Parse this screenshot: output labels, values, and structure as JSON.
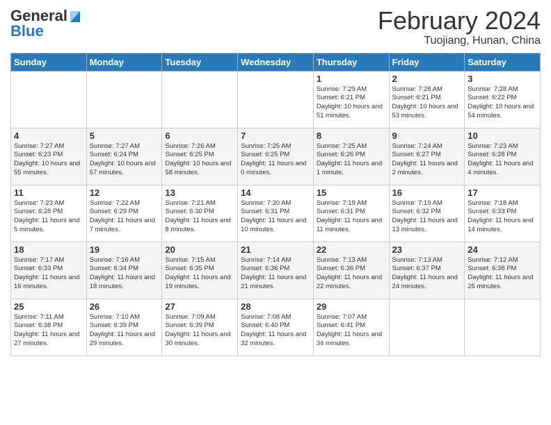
{
  "header": {
    "logo_general": "General",
    "logo_blue": "Blue",
    "title": "February 2024",
    "subtitle": "Tuojiang, Hunan, China"
  },
  "days_of_week": [
    "Sunday",
    "Monday",
    "Tuesday",
    "Wednesday",
    "Thursday",
    "Friday",
    "Saturday"
  ],
  "weeks": [
    [
      {
        "day": "",
        "info": ""
      },
      {
        "day": "",
        "info": ""
      },
      {
        "day": "",
        "info": ""
      },
      {
        "day": "",
        "info": ""
      },
      {
        "day": "1",
        "info": "Sunrise: 7:29 AM\nSunset: 6:21 PM\nDaylight: 10 hours\nand 51 minutes."
      },
      {
        "day": "2",
        "info": "Sunrise: 7:28 AM\nSunset: 6:21 PM\nDaylight: 10 hours\nand 53 minutes."
      },
      {
        "day": "3",
        "info": "Sunrise: 7:28 AM\nSunset: 6:22 PM\nDaylight: 10 hours\nand 54 minutes."
      }
    ],
    [
      {
        "day": "4",
        "info": "Sunrise: 7:27 AM\nSunset: 6:23 PM\nDaylight: 10 hours\nand 55 minutes."
      },
      {
        "day": "5",
        "info": "Sunrise: 7:27 AM\nSunset: 6:24 PM\nDaylight: 10 hours\nand 57 minutes."
      },
      {
        "day": "6",
        "info": "Sunrise: 7:26 AM\nSunset: 6:25 PM\nDaylight: 10 hours\nand 58 minutes."
      },
      {
        "day": "7",
        "info": "Sunrise: 7:25 AM\nSunset: 6:25 PM\nDaylight: 11 hours\nand 0 minutes."
      },
      {
        "day": "8",
        "info": "Sunrise: 7:25 AM\nSunset: 6:26 PM\nDaylight: 11 hours\nand 1 minute."
      },
      {
        "day": "9",
        "info": "Sunrise: 7:24 AM\nSunset: 6:27 PM\nDaylight: 11 hours\nand 2 minutes."
      },
      {
        "day": "10",
        "info": "Sunrise: 7:23 AM\nSunset: 6:28 PM\nDaylight: 11 hours\nand 4 minutes."
      }
    ],
    [
      {
        "day": "11",
        "info": "Sunrise: 7:23 AM\nSunset: 6:28 PM\nDaylight: 11 hours\nand 5 minutes."
      },
      {
        "day": "12",
        "info": "Sunrise: 7:22 AM\nSunset: 6:29 PM\nDaylight: 11 hours\nand 7 minutes."
      },
      {
        "day": "13",
        "info": "Sunrise: 7:21 AM\nSunset: 6:30 PM\nDaylight: 11 hours\nand 8 minutes."
      },
      {
        "day": "14",
        "info": "Sunrise: 7:20 AM\nSunset: 6:31 PM\nDaylight: 11 hours\nand 10 minutes."
      },
      {
        "day": "15",
        "info": "Sunrise: 7:19 AM\nSunset: 6:31 PM\nDaylight: 11 hours\nand 11 minutes."
      },
      {
        "day": "16",
        "info": "Sunrise: 7:19 AM\nSunset: 6:32 PM\nDaylight: 11 hours\nand 13 minutes."
      },
      {
        "day": "17",
        "info": "Sunrise: 7:18 AM\nSunset: 6:33 PM\nDaylight: 11 hours\nand 14 minutes."
      }
    ],
    [
      {
        "day": "18",
        "info": "Sunrise: 7:17 AM\nSunset: 6:33 PM\nDaylight: 11 hours\nand 16 minutes."
      },
      {
        "day": "19",
        "info": "Sunrise: 7:16 AM\nSunset: 6:34 PM\nDaylight: 11 hours\nand 18 minutes."
      },
      {
        "day": "20",
        "info": "Sunrise: 7:15 AM\nSunset: 6:35 PM\nDaylight: 11 hours\nand 19 minutes."
      },
      {
        "day": "21",
        "info": "Sunrise: 7:14 AM\nSunset: 6:36 PM\nDaylight: 11 hours\nand 21 minutes."
      },
      {
        "day": "22",
        "info": "Sunrise: 7:13 AM\nSunset: 6:36 PM\nDaylight: 11 hours\nand 22 minutes."
      },
      {
        "day": "23",
        "info": "Sunrise: 7:13 AM\nSunset: 6:37 PM\nDaylight: 11 hours\nand 24 minutes."
      },
      {
        "day": "24",
        "info": "Sunrise: 7:12 AM\nSunset: 6:38 PM\nDaylight: 11 hours\nand 25 minutes."
      }
    ],
    [
      {
        "day": "25",
        "info": "Sunrise: 7:11 AM\nSunset: 6:38 PM\nDaylight: 11 hours\nand 27 minutes."
      },
      {
        "day": "26",
        "info": "Sunrise: 7:10 AM\nSunset: 6:39 PM\nDaylight: 11 hours\nand 29 minutes."
      },
      {
        "day": "27",
        "info": "Sunrise: 7:09 AM\nSunset: 6:39 PM\nDaylight: 11 hours\nand 30 minutes."
      },
      {
        "day": "28",
        "info": "Sunrise: 7:08 AM\nSunset: 6:40 PM\nDaylight: 11 hours\nand 32 minutes."
      },
      {
        "day": "29",
        "info": "Sunrise: 7:07 AM\nSunset: 6:41 PM\nDaylight: 11 hours\nand 34 minutes."
      },
      {
        "day": "",
        "info": ""
      },
      {
        "day": "",
        "info": ""
      }
    ]
  ]
}
